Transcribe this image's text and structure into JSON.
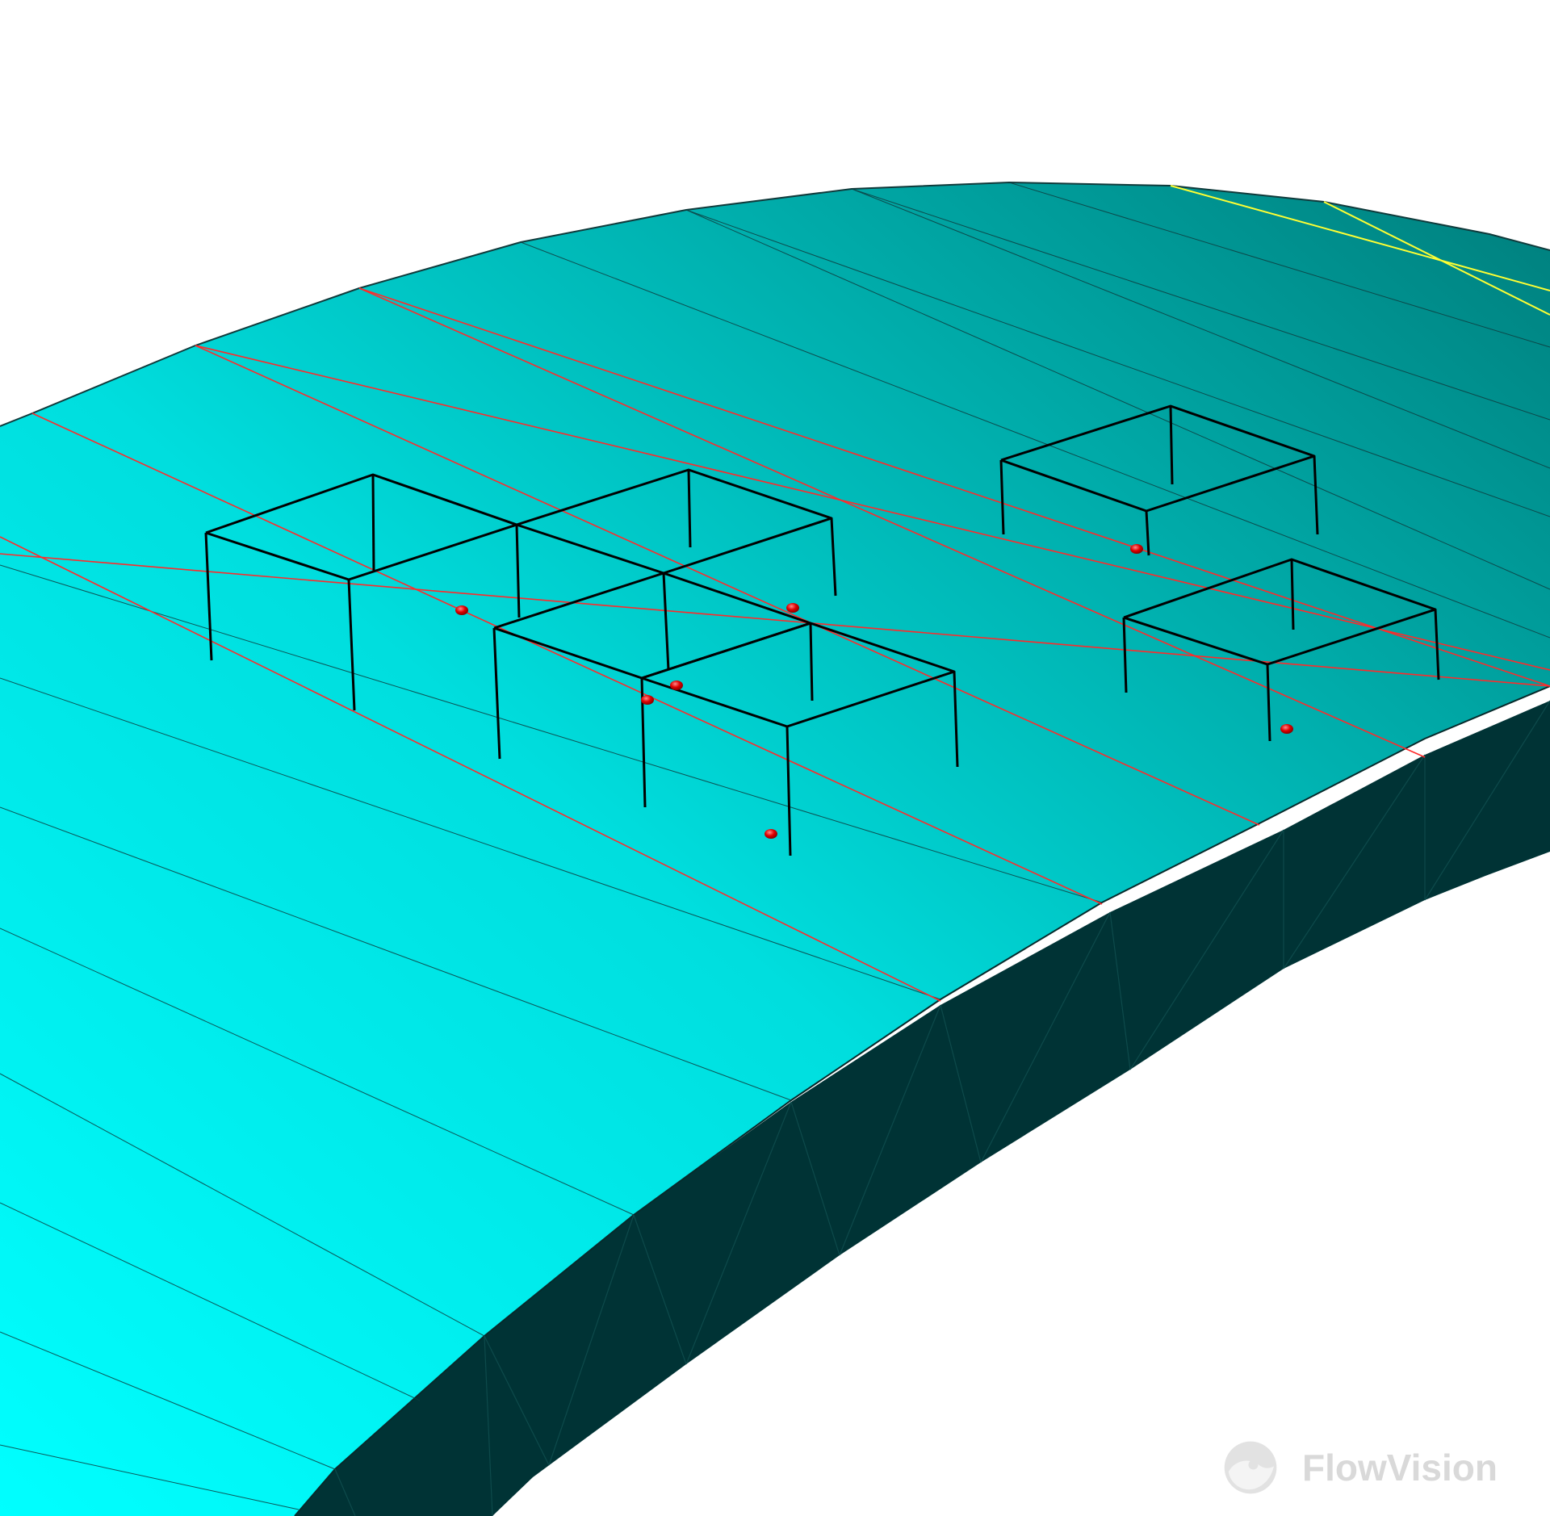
{
  "app": {
    "watermark_text": "FlowVision"
  },
  "colors": {
    "background": "#ffffff",
    "top_surface_near": "#00ffff",
    "top_surface_far": "#008a88",
    "side_wall": "#003335",
    "mesh_line": "#0f3c3e",
    "boundary_line_red": "#ff2020",
    "boundary_line_yellow": "#ffff33",
    "probe_point": "#dd0000",
    "frame_edge": "#000000",
    "watermark": "#d9d9d9"
  },
  "icons": {
    "logo": "flowvision-logo-icon",
    "probe": "probe-point-icon"
  }
}
